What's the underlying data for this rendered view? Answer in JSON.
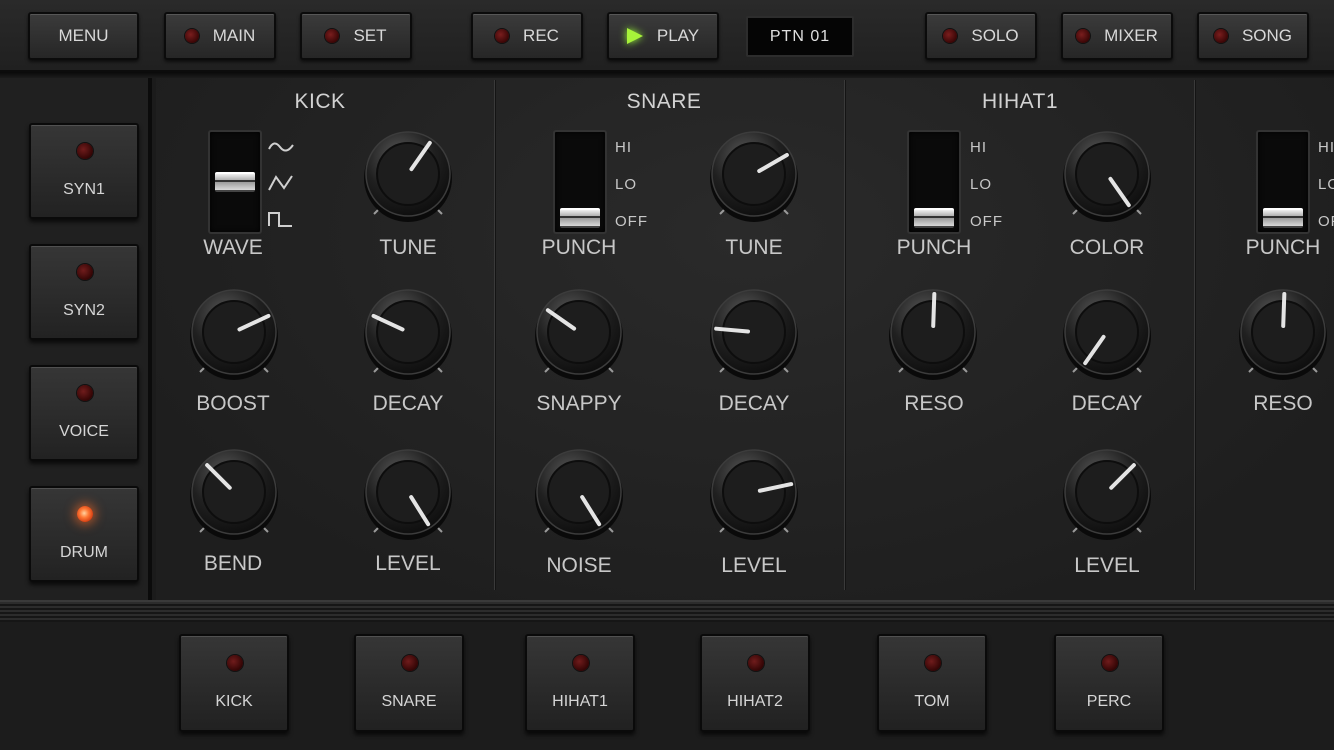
{
  "topbar": {
    "menu": "MENU",
    "main": "MAIN",
    "set": "SET",
    "rec": "REC",
    "play": "PLAY",
    "pattern": "PTN 01",
    "solo": "SOLO",
    "mixer": "MIXER",
    "song": "SONG"
  },
  "sidebar": {
    "items": [
      {
        "label": "SYN1",
        "active": false
      },
      {
        "label": "SYN2",
        "active": false
      },
      {
        "label": "VOICE",
        "active": false
      },
      {
        "label": "DRUM",
        "active": true
      }
    ]
  },
  "sections": {
    "kick": {
      "title": "KICK",
      "wave_label": "WAVE",
      "wave_options": [
        "sine",
        "saw",
        "square"
      ],
      "tune_label": "TUNE",
      "boost_label": "BOOST",
      "decay_label": "DECAY",
      "bend_label": "BEND",
      "level_label": "LEVEL"
    },
    "snare": {
      "title": "SNARE",
      "punch_label": "PUNCH",
      "punch_options": [
        "HI",
        "LO",
        "OFF"
      ],
      "tune_label": "TUNE",
      "snappy_label": "SNAPPY",
      "decay_label": "DECAY",
      "noise_label": "NOISE",
      "level_label": "LEVEL"
    },
    "hihat1": {
      "title": "HIHAT1",
      "punch_label": "PUNCH",
      "punch_options": [
        "HI",
        "LO",
        "OFF"
      ],
      "color_label": "COLOR",
      "reso_label": "RESO",
      "decay_label": "DECAY",
      "level_label": "LEVEL"
    },
    "partial": {
      "punch_label": "PUNCH",
      "punch_options": [
        "HI",
        "LO",
        "OFF"
      ],
      "reso_label": "RESO"
    }
  },
  "bottom": {
    "items": [
      "KICK",
      "SNARE",
      "HIHAT1",
      "HIHAT2",
      "TOM",
      "PERC"
    ]
  },
  "colors": {
    "led_off": "#5a1212",
    "led_on": "#ff7a36",
    "play_accent": "#a7f23a"
  }
}
